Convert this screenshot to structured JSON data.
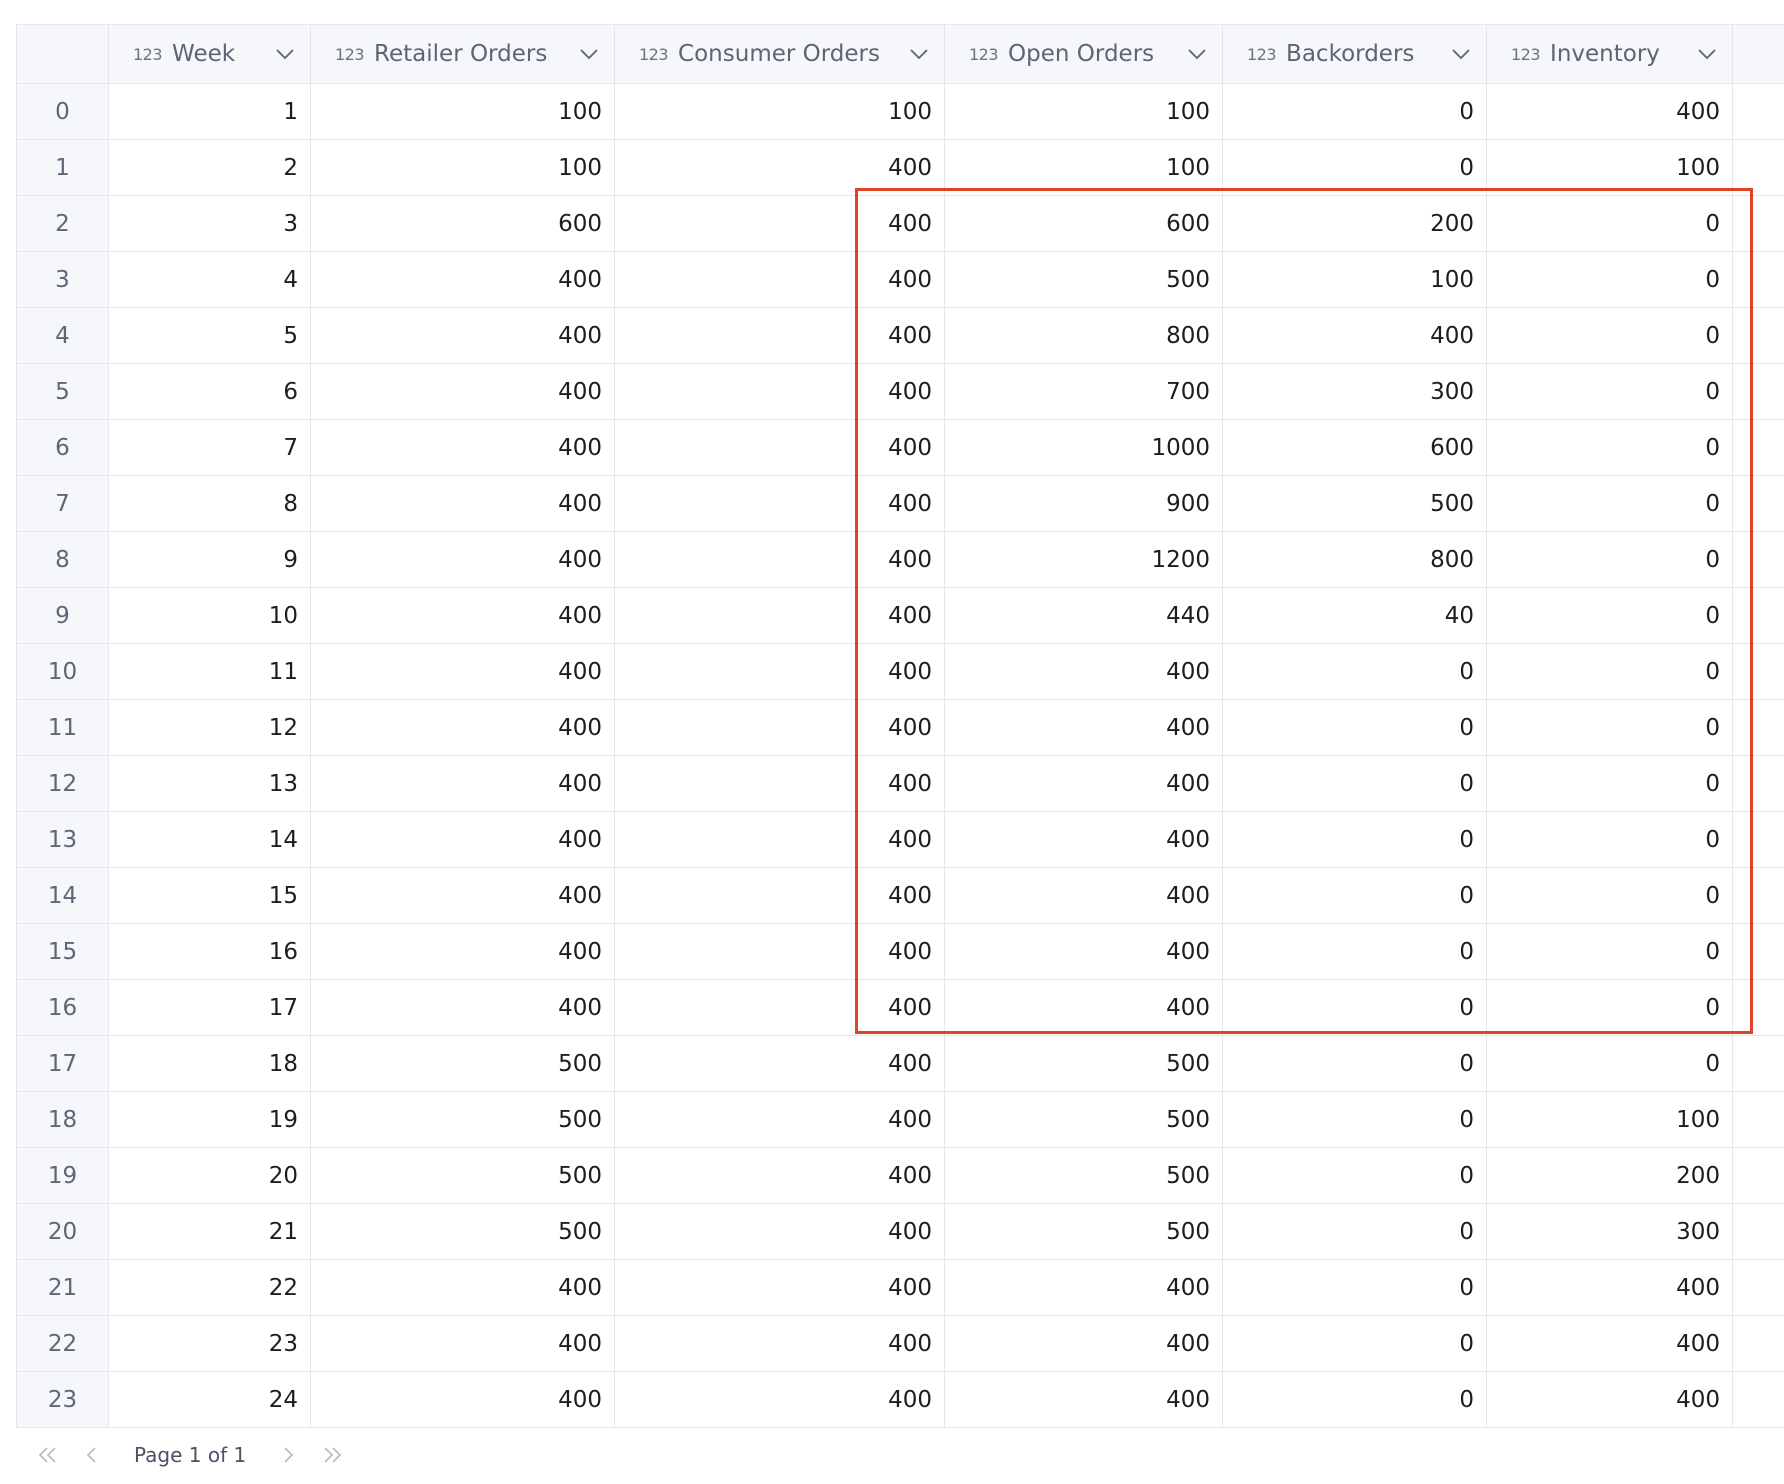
{
  "columns": [
    {
      "type_icon": "123",
      "title": "Week"
    },
    {
      "type_icon": "123",
      "title": "Retailer Orders"
    },
    {
      "type_icon": "123",
      "title": "Consumer Orders"
    },
    {
      "type_icon": "123",
      "title": "Open Orders"
    },
    {
      "type_icon": "123",
      "title": "Backorders"
    },
    {
      "type_icon": "123",
      "title": "Inventory"
    }
  ],
  "rows": [
    {
      "index": "0",
      "cells": [
        "1",
        "100",
        "100",
        "100",
        "0",
        "400"
      ]
    },
    {
      "index": "1",
      "cells": [
        "2",
        "100",
        "400",
        "100",
        "0",
        "100"
      ]
    },
    {
      "index": "2",
      "cells": [
        "3",
        "600",
        "400",
        "600",
        "200",
        "0"
      ]
    },
    {
      "index": "3",
      "cells": [
        "4",
        "400",
        "400",
        "500",
        "100",
        "0"
      ]
    },
    {
      "index": "4",
      "cells": [
        "5",
        "400",
        "400",
        "800",
        "400",
        "0"
      ]
    },
    {
      "index": "5",
      "cells": [
        "6",
        "400",
        "400",
        "700",
        "300",
        "0"
      ]
    },
    {
      "index": "6",
      "cells": [
        "7",
        "400",
        "400",
        "1000",
        "600",
        "0"
      ]
    },
    {
      "index": "7",
      "cells": [
        "8",
        "400",
        "400",
        "900",
        "500",
        "0"
      ]
    },
    {
      "index": "8",
      "cells": [
        "9",
        "400",
        "400",
        "1200",
        "800",
        "0"
      ]
    },
    {
      "index": "9",
      "cells": [
        "10",
        "400",
        "400",
        "440",
        "40",
        "0"
      ]
    },
    {
      "index": "10",
      "cells": [
        "11",
        "400",
        "400",
        "400",
        "0",
        "0"
      ]
    },
    {
      "index": "11",
      "cells": [
        "12",
        "400",
        "400",
        "400",
        "0",
        "0"
      ]
    },
    {
      "index": "12",
      "cells": [
        "13",
        "400",
        "400",
        "400",
        "0",
        "0"
      ]
    },
    {
      "index": "13",
      "cells": [
        "14",
        "400",
        "400",
        "400",
        "0",
        "0"
      ]
    },
    {
      "index": "14",
      "cells": [
        "15",
        "400",
        "400",
        "400",
        "0",
        "0"
      ]
    },
    {
      "index": "15",
      "cells": [
        "16",
        "400",
        "400",
        "400",
        "0",
        "0"
      ]
    },
    {
      "index": "16",
      "cells": [
        "17",
        "400",
        "400",
        "400",
        "0",
        "0"
      ]
    },
    {
      "index": "17",
      "cells": [
        "18",
        "500",
        "400",
        "500",
        "0",
        "0"
      ]
    },
    {
      "index": "18",
      "cells": [
        "19",
        "500",
        "400",
        "500",
        "0",
        "100"
      ]
    },
    {
      "index": "19",
      "cells": [
        "20",
        "500",
        "400",
        "500",
        "0",
        "200"
      ]
    },
    {
      "index": "20",
      "cells": [
        "21",
        "500",
        "400",
        "500",
        "0",
        "300"
      ]
    },
    {
      "index": "21",
      "cells": [
        "22",
        "400",
        "400",
        "400",
        "0",
        "400"
      ]
    },
    {
      "index": "22",
      "cells": [
        "23",
        "400",
        "400",
        "400",
        "0",
        "400"
      ]
    },
    {
      "index": "23",
      "cells": [
        "24",
        "400",
        "400",
        "400",
        "0",
        "400"
      ]
    }
  ],
  "pagination": {
    "label": "Page 1 of 1",
    "icons": [
      "first-page-icon",
      "previous-page-icon",
      "next-page-icon",
      "last-page-icon"
    ]
  },
  "colors": {
    "header_bg": "#f5f7fa",
    "grid_line": "#e3e6ec",
    "highlight": "#e0422b"
  }
}
